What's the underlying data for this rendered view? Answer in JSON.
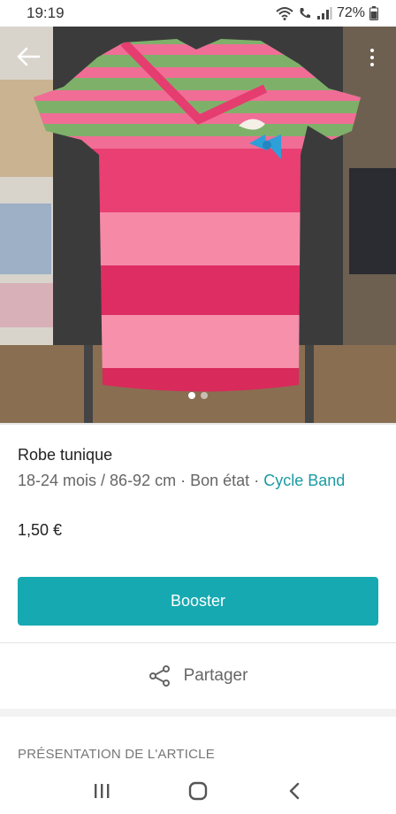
{
  "status_bar": {
    "time": "19:19",
    "battery": "72%"
  },
  "item": {
    "title": "Robe tunique",
    "size": "18-24 mois / 86-92 cm",
    "separator": "·",
    "condition": "Bon état",
    "brand": "Cycle Band",
    "price": "1,50 €"
  },
  "photo": {
    "image_count": 2,
    "current_image": 1,
    "subject": "pink-and-green-striped-knit-dress"
  },
  "actions": {
    "boost_label": "Booster",
    "share_label": "Partager"
  },
  "section": {
    "title": "PRÉSENTATION DE L'ARTICLE"
  },
  "colors": {
    "accent": "#17a9b1",
    "brand_link": "#1a9ba3"
  }
}
